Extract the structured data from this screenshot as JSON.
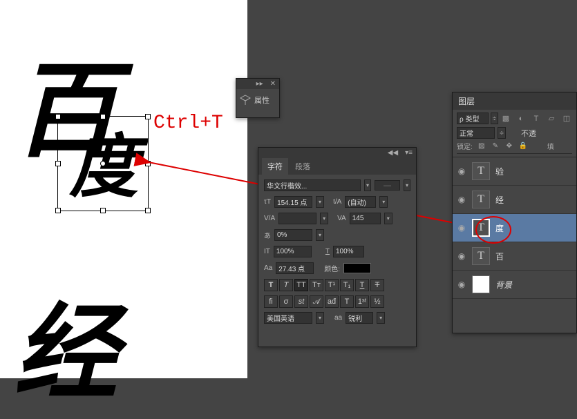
{
  "canvas": {
    "bai": "百",
    "du": "度",
    "jing": "经"
  },
  "annotation": "Ctrl+T",
  "props_panel": {
    "title": "属性"
  },
  "char_panel": {
    "tab_character": "字符",
    "tab_paragraph": "段落",
    "font_name": "华文行楷效...",
    "font_style": "-",
    "size_label": "T",
    "size_value": "154.15 点",
    "leading_label": "tA",
    "leading_value": "(自动)",
    "va_label": "V/A",
    "va2_label": "VA",
    "tracking_value": "145",
    "scale_label": "あ",
    "scale_value": "0%",
    "vert_label": "IT",
    "vert_value": "100%",
    "horiz_label": "T",
    "horiz_value": "100%",
    "baseline_label": "Aa",
    "baseline_value": "27.43 点",
    "color_label": "颜色:",
    "lang_value": "美国英语",
    "aa_label": "aa",
    "sharpness_value": "锐利"
  },
  "layers_panel": {
    "title": "图层",
    "kind_label": "ρ 类型",
    "blend_mode": "正常",
    "opacity_label": "不透",
    "lock_label": "锁定:",
    "fill_label": "填",
    "layers": [
      {
        "name": "验",
        "type": "T"
      },
      {
        "name": "经",
        "type": "T"
      },
      {
        "name": "度",
        "type": "T",
        "selected": true
      },
      {
        "name": "百",
        "type": "T"
      },
      {
        "name": "背景",
        "type": "bg"
      }
    ]
  }
}
